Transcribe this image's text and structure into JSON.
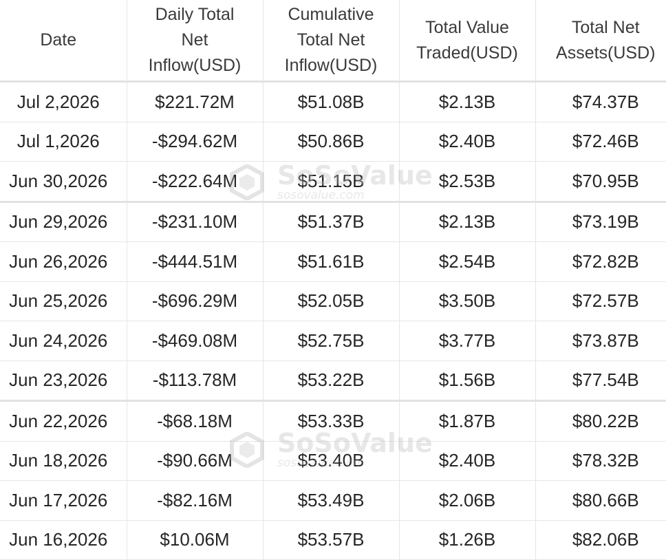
{
  "headers": {
    "date": "Date",
    "daily": "Daily Total\nNet\nInflow(USD)",
    "cumulative": "Cumulative\nTotal Net\nInflow(USD)",
    "traded": "Total Value\nTraded(USD)",
    "assets": "Total Net\nAssets(USD)"
  },
  "rows": [
    {
      "date": "Jul 2,2026",
      "daily": "$221.72M",
      "daily_sign": "pos",
      "cumulative": "$51.08B",
      "traded": "$2.13B",
      "assets": "$74.37B"
    },
    {
      "date": "Jul 1,2026",
      "daily": "-$294.62M",
      "daily_sign": "neg",
      "cumulative": "$50.86B",
      "traded": "$2.40B",
      "assets": "$72.46B"
    },
    {
      "date": "Jun 30,2026",
      "daily": "-$222.64M",
      "daily_sign": "neg",
      "cumulative": "$51.15B",
      "traded": "$2.53B",
      "assets": "$70.95B"
    },
    {
      "date": "Jun 29,2026",
      "daily": "-$231.10M",
      "daily_sign": "neg",
      "cumulative": "$51.37B",
      "traded": "$2.13B",
      "assets": "$73.19B"
    },
    {
      "date": "Jun 26,2026",
      "daily": "-$444.51M",
      "daily_sign": "neg",
      "cumulative": "$51.61B",
      "traded": "$2.54B",
      "assets": "$72.82B"
    },
    {
      "date": "Jun 25,2026",
      "daily": "-$696.29M",
      "daily_sign": "neg",
      "cumulative": "$52.05B",
      "traded": "$3.50B",
      "assets": "$72.57B"
    },
    {
      "date": "Jun 24,2026",
      "daily": "-$469.08M",
      "daily_sign": "neg",
      "cumulative": "$52.75B",
      "traded": "$3.77B",
      "assets": "$73.87B"
    },
    {
      "date": "Jun 23,2026",
      "daily": "-$113.78M",
      "daily_sign": "neg",
      "cumulative": "$53.22B",
      "traded": "$1.56B",
      "assets": "$77.54B"
    },
    {
      "date": "Jun 22,2026",
      "daily": "-$68.18M",
      "daily_sign": "neg",
      "cumulative": "$53.33B",
      "traded": "$1.87B",
      "assets": "$80.22B"
    },
    {
      "date": "Jun 18,2026",
      "daily": "-$90.66M",
      "daily_sign": "neg",
      "cumulative": "$53.40B",
      "traded": "$2.40B",
      "assets": "$78.32B"
    },
    {
      "date": "Jun 17,2026",
      "daily": "-$82.16M",
      "daily_sign": "neg",
      "cumulative": "$53.49B",
      "traded": "$2.06B",
      "assets": "$80.66B"
    },
    {
      "date": "Jun 16,2026",
      "daily": "$10.06M",
      "daily_sign": "pos",
      "cumulative": "$53.57B",
      "traded": "$1.26B",
      "assets": "$82.06B"
    }
  ],
  "watermark": {
    "brand": "SoSoValue",
    "url": "sosovalue.com",
    "icon": "sosovalue-logo-icon"
  },
  "colors": {
    "positive": "#22a04e",
    "negative": "#e53a3a"
  }
}
